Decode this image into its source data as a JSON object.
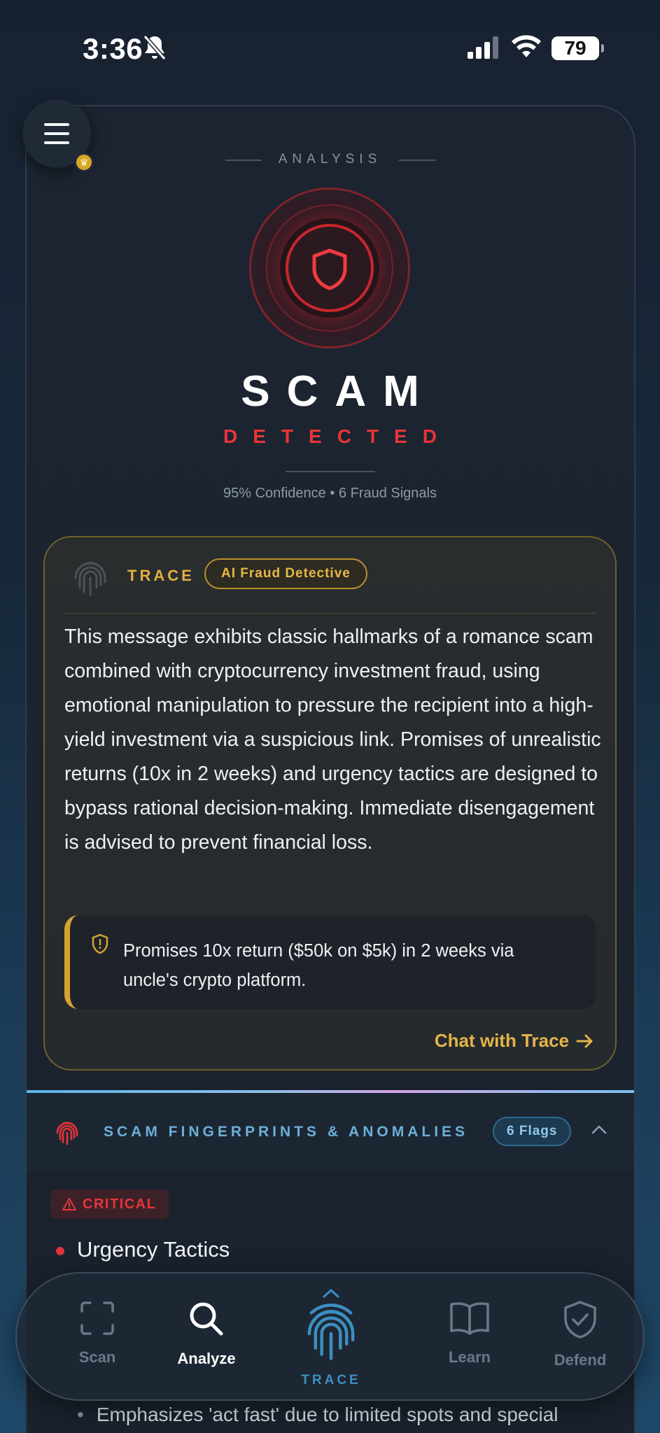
{
  "status_bar": {
    "time": "3:36",
    "battery": "79"
  },
  "header": {
    "section_label": "ANALYSIS",
    "verdict": "SCAM",
    "verdict_sub": "DETECTED",
    "confidence_line": "95% Confidence • 6 Fraud Signals"
  },
  "trace_card": {
    "title": "TRACE",
    "badge": "AI Fraud Detective",
    "summary": "This message exhibits classic hallmarks of a romance scam combined with cryptocurrency investment fraud, using emotional manipulation to pressure the recipient into a high-yield investment via a suspicious link. Promises of unrealistic returns (10x in 2 weeks) and urgency tactics are designed to bypass rational decision-making. Immediate disengagement is advised to prevent financial loss.",
    "highlight": "Promises 10x return ($50k on $5k) in 2 weeks via uncle's crypto platform.",
    "chat_link": "Chat with Trace"
  },
  "fingerprints": {
    "title": "SCAM FINGERPRINTS & ANOMALIES",
    "flags_badge": "6 Flags",
    "severity": "CRITICAL",
    "item_title": "Urgency Tactics",
    "item_bullet": "Emphasizes 'act fast' due to limited spots and special"
  },
  "bottom_nav": {
    "items": [
      {
        "label": "Scan",
        "icon": "scan-frame-icon"
      },
      {
        "label": "Analyze",
        "icon": "search-icon"
      },
      {
        "label": "TRACE",
        "icon": "fingerprint-icon"
      },
      {
        "label": "Learn",
        "icon": "book-icon"
      },
      {
        "label": "Defend",
        "icon": "shield-check-icon"
      }
    ],
    "active": "Analyze"
  },
  "colors": {
    "danger": "#e8343a",
    "gold": "#e2b140",
    "accent_blue": "#6ab0d8"
  }
}
